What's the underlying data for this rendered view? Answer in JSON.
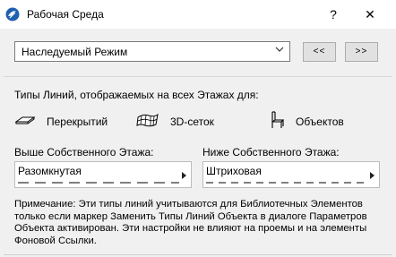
{
  "window": {
    "title": "Рабочая Среда",
    "help_label": "?",
    "close_label": "✕"
  },
  "mode": {
    "selected": "Наследуемый Режим",
    "prev_label": "<<",
    "next_label": ">>"
  },
  "line_types": {
    "heading": "Типы Линий, отображаемых на всех Этажах для:",
    "options": [
      {
        "label": "Перекрытий",
        "icon": "slab-icon"
      },
      {
        "label": "3D-сеток",
        "icon": "mesh-icon"
      },
      {
        "label": "Объектов",
        "icon": "chair-icon"
      }
    ]
  },
  "above": {
    "label": "Выше Собственного Этажа:",
    "value": "Разомкнутая"
  },
  "below": {
    "label": "Ниже Собственного Этажа:",
    "value": "Штриховая"
  },
  "note": "Примечание: Эти типы линий учитываются для Библиотечных Элементов только если маркер Заменить Типы Линий Объекта в диалоге Параметров Объекта активирован. Эти настройки не влияют на проемы и на элементы Фоновой Ссылки."
}
